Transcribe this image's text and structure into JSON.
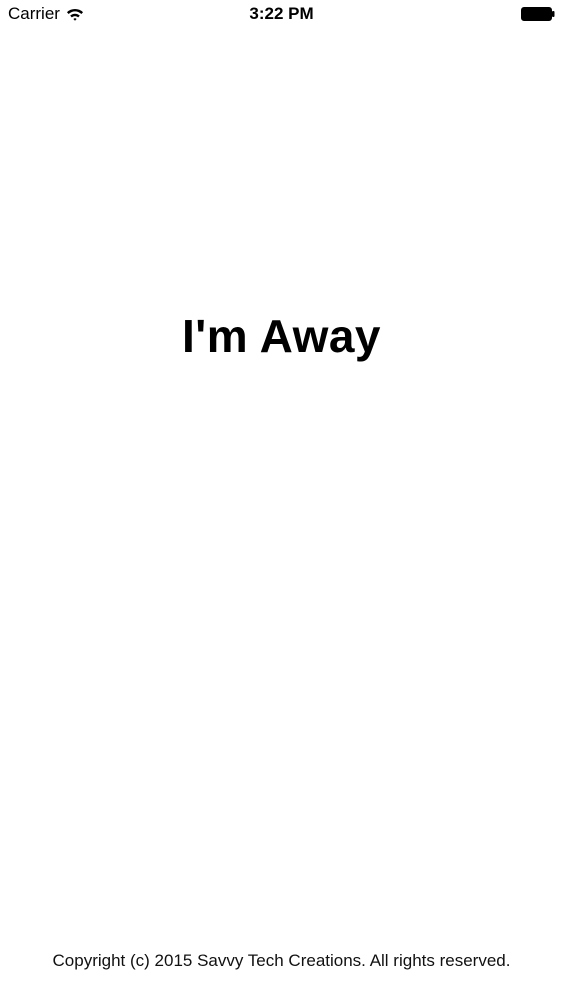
{
  "status_bar": {
    "carrier": "Carrier",
    "time": "3:22 PM",
    "wifi_icon": "wifi-icon",
    "battery_icon": "battery-icon"
  },
  "main": {
    "title": "I'm Away"
  },
  "footer": {
    "copyright": "Copyright (c) 2015 Savvy Tech Creations. All rights reserved."
  },
  "colors": {
    "background": "#ffffff",
    "text": "#000000"
  }
}
